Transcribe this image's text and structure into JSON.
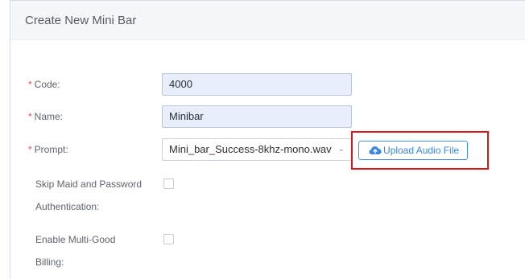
{
  "panel": {
    "title": "Create New Mini Bar"
  },
  "form": {
    "required_marker": "*",
    "code": {
      "label": "Code:",
      "value": "4000"
    },
    "name": {
      "label": "Name:",
      "value": "Minibar"
    },
    "prompt": {
      "label": "Prompt:",
      "selected": "Mini_bar_Success-8khz-mono.wav",
      "upload_button": "Upload Audio File"
    },
    "skip_auth": {
      "label_line1": "Skip Maid and Password",
      "label_line2": "Authentication:",
      "checked": false
    },
    "multi_good": {
      "label_line1": "Enable Multi-Good",
      "label_line2": "Billing:",
      "checked": false
    }
  },
  "icons": {
    "upload": "cloud-upload-icon",
    "dropdown": "chevron-down-icon"
  },
  "colors": {
    "accent": "#3a86e0",
    "required": "#e64b4b",
    "highlight": "#d7191c",
    "field_bg": "#e8eefb"
  }
}
